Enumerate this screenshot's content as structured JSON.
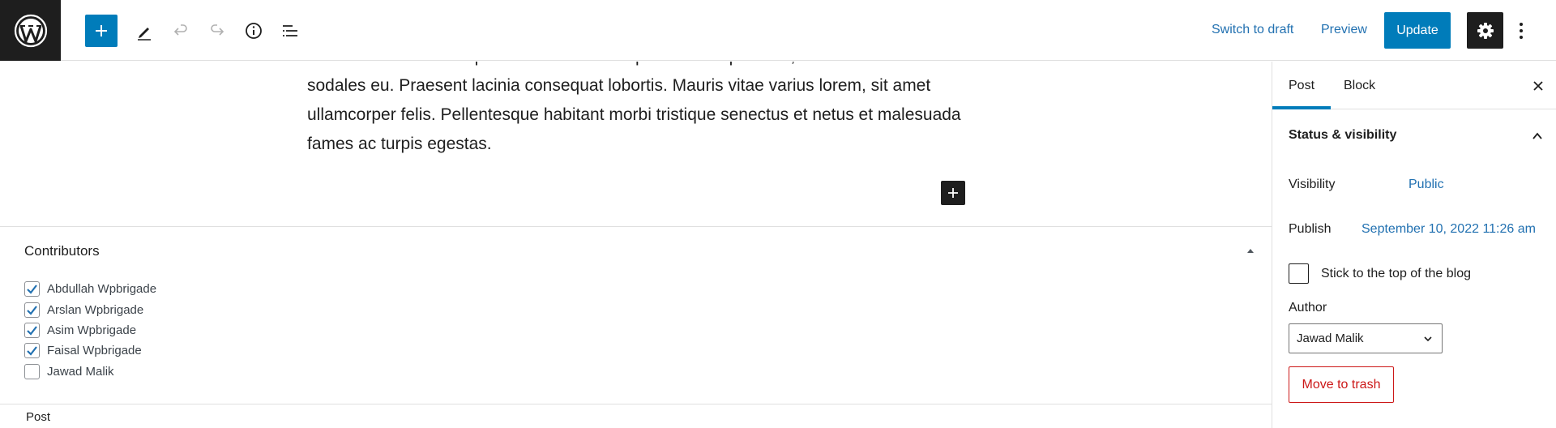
{
  "toolbar": {
    "switch_to_draft": "Switch to draft",
    "preview": "Preview",
    "update": "Update"
  },
  "editor": {
    "paragraph_text": "tincidunt lorem eu tempus. Praesent ac tempor ullamcorper nibh, sed lacinia sem sodales eu. Praesent lacinia consequat lobortis. Mauris vitae varius lorem, sit amet ullamcorper felis. Pellentesque habitant morbi tristique senectus et netus et malesuada fames ac turpis egestas."
  },
  "metabox": {
    "title": "Contributors",
    "contributors": [
      {
        "name": "Abdullah Wpbrigade",
        "checked": true
      },
      {
        "name": "Arslan Wpbrigade",
        "checked": true
      },
      {
        "name": "Asim Wpbrigade",
        "checked": true
      },
      {
        "name": "Faisal Wpbrigade",
        "checked": true
      },
      {
        "name": "Jawad Malik",
        "checked": false
      }
    ]
  },
  "footer": {
    "breadcrumb": "Post"
  },
  "sidebar": {
    "tabs": [
      {
        "label": "Post",
        "active": true
      },
      {
        "label": "Block",
        "active": false
      }
    ],
    "panel_title": "Status & visibility",
    "visibility_label": "Visibility",
    "visibility_value": "Public",
    "publish_label": "Publish",
    "publish_value": "September 10, 2022 11:26 am",
    "sticky_label": "Stick to the top of the blog",
    "author_label": "Author",
    "author_value": "Jawad Malik",
    "trash_label": "Move to trash"
  },
  "colors": {
    "accent": "#007cba",
    "link": "#2271b1",
    "danger": "#cc1818",
    "dark": "#1e1e1e"
  }
}
